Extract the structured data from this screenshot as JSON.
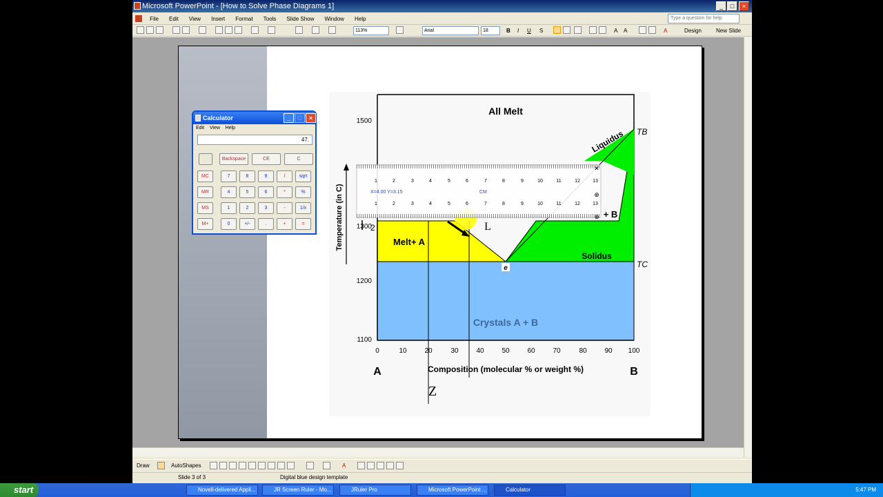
{
  "window": {
    "title": "Microsoft PowerPoint - [How to Solve Phase Diagrams 1]"
  },
  "menu": [
    "File",
    "Edit",
    "View",
    "Insert",
    "Format",
    "Tools",
    "Slide Show",
    "Window",
    "Help"
  ],
  "help_placeholder": "Type a question for help",
  "toolbar": {
    "zoom": "113%",
    "font": "Arial",
    "size": "18",
    "design": "Design",
    "new_slide": "New Slide"
  },
  "calculator": {
    "title": "Calculator",
    "menu": [
      "Edit",
      "View",
      "Help"
    ],
    "display": "47.",
    "top_keys": [
      "Backspace",
      "CE",
      "C"
    ],
    "rows": [
      [
        "MC",
        "7",
        "8",
        "9",
        "/",
        "sqrt"
      ],
      [
        "MR",
        "4",
        "5",
        "6",
        "*",
        "%"
      ],
      [
        "MS",
        "1",
        "2",
        "3",
        "-",
        "1/x"
      ],
      [
        "M+",
        "0",
        "+/-",
        ".",
        "+",
        "="
      ]
    ]
  },
  "chart": {
    "region_labels": {
      "all_melt": "All Melt",
      "melt_a": "Melt+ A",
      "crystals": "Crystals A + B",
      "b_region": "+ B"
    },
    "curve_labels": {
      "liquidus": "Liquidus",
      "solidus": "Solidus"
    },
    "point_labels": {
      "tb": "TB",
      "tc": "TC",
      "e": "e",
      "a": "A",
      "b": "B",
      "z": "Z",
      "l": "L"
    },
    "ylabel": "Temperature (in C)",
    "xlabel": "Composition (molecular % or weight %)",
    "yticks": [
      "1500",
      "1300",
      "1200",
      "1100"
    ],
    "xticks": [
      "0",
      "10",
      "20",
      "30",
      "40",
      "50",
      "60",
      "70",
      "80",
      "90",
      "100"
    ]
  },
  "ruler": {
    "units": "CM",
    "readout": "X=4.00   Y=3.15",
    "numbers": [
      "1",
      "2",
      "3",
      "4",
      "5",
      "6",
      "7",
      "8",
      "9",
      "10",
      "11",
      "12",
      "13"
    ]
  },
  "drawbar": {
    "draw": "Draw",
    "autoshapes": "AutoShapes"
  },
  "status": {
    "slide": "Slide 3 of 3",
    "template": "Digital blue design template"
  },
  "taskbar": {
    "start": "start",
    "tasks": [
      "Novell-delivered Appli...",
      "JR Screen Ruler - Mo...",
      "JRuler Pro",
      "Microsoft PowerPoint ...",
      "Calculator"
    ],
    "clock": "5:47 PM"
  }
}
